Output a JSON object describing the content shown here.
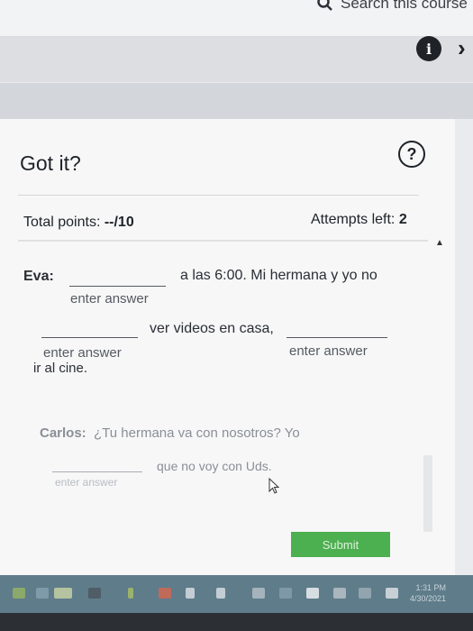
{
  "header": {
    "search_text": "Search this course"
  },
  "toolbar": {
    "info_label": "i",
    "next_label": "›"
  },
  "question": {
    "title": "Got it?",
    "help_label": "?",
    "total_points_label": "Total points: ",
    "total_points_value": "--/10",
    "attempts_label": "Attempts left: ",
    "attempts_value": "2"
  },
  "exercise": {
    "eva_speaker": "Eva:",
    "eva_line1_rest": "a las 6:00. Mi hermana y yo no",
    "eva_line2_text": "ver videos en casa,",
    "eva_line3_text": "ir al cine.",
    "carlos_speaker": "Carlos:",
    "carlos_line1_text": "¿Tu hermana va con nosotros? Yo",
    "carlos_line2_text": "que no voy con Uds.",
    "placeholder": "enter answer"
  },
  "actions": {
    "submit_label": "Submit"
  },
  "taskbar": {
    "time": "1:31 PM",
    "date": "4/30/2021"
  }
}
